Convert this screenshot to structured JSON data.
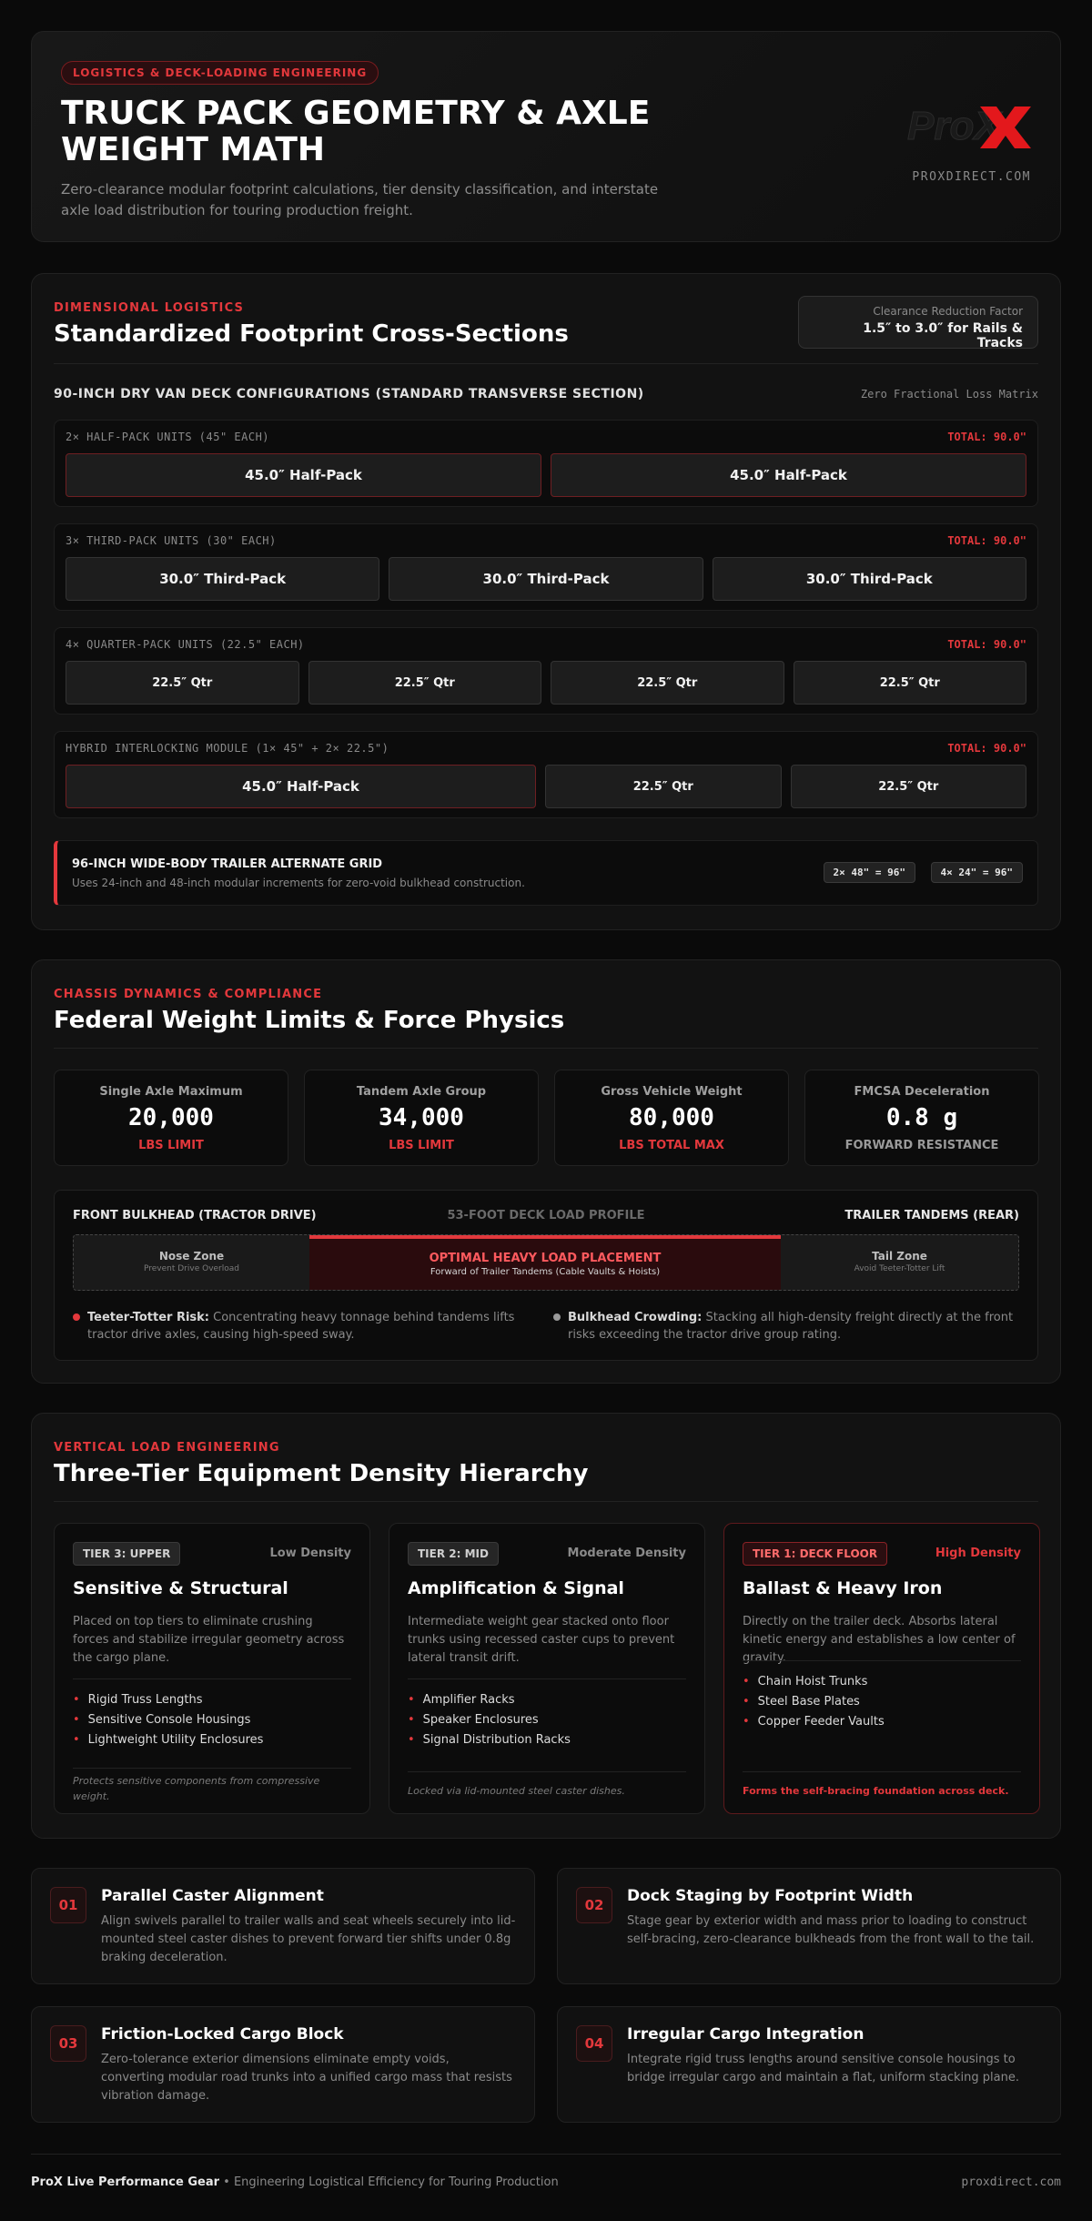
{
  "header": {
    "badge": "LOGISTICS & DECK-LOADING ENGINEERING",
    "title": "TRUCK PACK GEOMETRY & AXLE WEIGHT MATH",
    "subtitle": "Zero-clearance modular footprint calculations, tier density classification, and interstate axle load distribution for touring production freight.",
    "logo_text": "ProX",
    "site": "PROXDIRECT.COM"
  },
  "footprint": {
    "eyebrow": "DIMENSIONAL LOGISTICS",
    "title": "Standardized Footprint Cross-Sections",
    "clearance_label": "Clearance Reduction Factor",
    "clearance_value": "1.5″ to 3.0″ for Rails & Tracks",
    "section_title": "90-INCH DRY VAN DECK CONFIGURATIONS (STANDARD TRANSVERSE SECTION)",
    "section_note": "Zero Fractional Loss Matrix",
    "decks": [
      {
        "label": "2× HALF-PACK UNITS (45\" EACH)",
        "total": "TOTAL: 90.0\"",
        "units": [
          "45.0″ Half-Pack",
          "45.0″ Half-Pack"
        ]
      },
      {
        "label": "3× THIRD-PACK UNITS (30\" EACH)",
        "total": "TOTAL: 90.0\"",
        "units": [
          "30.0″ Third-Pack",
          "30.0″ Third-Pack",
          "30.0″ Third-Pack"
        ]
      },
      {
        "label": "4× QUARTER-PACK UNITS (22.5\" EACH)",
        "total": "TOTAL: 90.0\"",
        "units": [
          "22.5″ Qtr",
          "22.5″ Qtr",
          "22.5″ Qtr",
          "22.5″ Qtr"
        ]
      },
      {
        "label": "HYBRID INTERLOCKING MODULE (1× 45\" + 2× 22.5\")",
        "total": "TOTAL: 90.0\"",
        "units": [
          "45.0″ Half-Pack",
          "22.5″ Qtr",
          "22.5″ Qtr"
        ]
      }
    ],
    "alt_title": "96-INCH WIDE-BODY TRAILER ALTERNATE GRID",
    "alt_desc": "Uses 24-inch and 48-inch modular increments for zero-void bulkhead construction.",
    "alt_chip1": "2× 48\" = 96\"",
    "alt_chip2": "4× 24\" = 96\""
  },
  "weights": {
    "eyebrow": "CHASSIS DYNAMICS & COMPLIANCE",
    "title": "Federal Weight Limits & Force Physics",
    "stats": [
      {
        "label": "Single Axle Maximum",
        "value": "20,000",
        "sub": "LBS LIMIT",
        "sub_color": "#e3383c"
      },
      {
        "label": "Tandem Axle Group",
        "value": "34,000",
        "sub": "LBS LIMIT",
        "sub_color": "#e3383c"
      },
      {
        "label": "Gross Vehicle Weight",
        "value": "80,000",
        "sub": "LBS TOTAL MAX",
        "sub_color": "#e3383c"
      },
      {
        "label": "FMCSA Deceleration",
        "value": "0.8 g",
        "sub": "FORWARD RESISTANCE",
        "sub_color": "#9a9a9a"
      }
    ],
    "profile": {
      "left": "FRONT BULKHEAD (TRACTOR DRIVE)",
      "center": "53-FOOT DECK LOAD PROFILE",
      "right": "TRAILER TANDEMS (REAR)",
      "nose_title": "Nose Zone",
      "nose_sub": "Prevent Drive Overload",
      "optimal_title": "OPTIMAL HEAVY LOAD PLACEMENT",
      "optimal_sub": "Forward of Trailer Tandems (Cable Vaults & Hoists)",
      "tail_title": "Tail Zone",
      "tail_sub": "Avoid Teeter-Totter Lift",
      "risk1_title": "Teeter-Totter Risk:",
      "risk1_text": "Concentrating heavy tonnage behind tandems lifts tractor drive axles, causing high-speed sway.",
      "risk2_title": "Bulkhead Crowding:",
      "risk2_text": "Stacking all high-density freight directly at the front risks exceeding the tractor drive group rating."
    }
  },
  "tiers": {
    "eyebrow": "VERTICAL LOAD ENGINEERING",
    "title": "Three-Tier Equipment Density Hierarchy",
    "items": [
      {
        "tag": "TIER 3: UPPER",
        "density": "Low Density",
        "title": "Sensitive & Structural",
        "desc": "Placed on top tiers to eliminate crushing forces and stabilize irregular geometry across the cargo plane.",
        "list": [
          "Rigid Truss Lengths",
          "Sensitive Console Housings",
          "Lightweight Utility Enclosures"
        ],
        "note": "Protects sensitive components from compressive weight."
      },
      {
        "tag": "TIER 2: MID",
        "density": "Moderate Density",
        "title": "Amplification & Signal",
        "desc": "Intermediate weight gear stacked onto floor trunks using recessed caster cups to prevent lateral transit drift.",
        "list": [
          "Amplifier Racks",
          "Speaker Enclosures",
          "Signal Distribution Racks"
        ],
        "note": "Locked via lid-mounted steel caster dishes."
      },
      {
        "tag": "TIER 1: DECK FLOOR",
        "density": "High Density",
        "title": "Ballast & Heavy Iron",
        "desc": "Directly on the trailer deck. Absorbs lateral kinetic energy and establishes a low center of gravity.",
        "list": [
          "Chain Hoist Trunks",
          "Steel Base Plates",
          "Copper Feeder Vaults"
        ],
        "note": "Forms the self-bracing foundation across deck."
      }
    ]
  },
  "steps": [
    {
      "num": "01",
      "title": "Parallel Caster Alignment",
      "desc": "Align swivels parallel to trailer walls and seat wheels securely into lid-mounted steel caster dishes to prevent forward tier shifts under 0.8g braking deceleration."
    },
    {
      "num": "02",
      "title": "Dock Staging by Footprint Width",
      "desc": "Stage gear by exterior width and mass prior to loading to construct self-bracing, zero-clearance bulkheads from the front wall to the tail."
    },
    {
      "num": "03",
      "title": "Friction-Locked Cargo Block",
      "desc": "Zero-tolerance exterior dimensions eliminate empty voids, converting modular road trunks into a unified cargo mass that resists vibration damage."
    },
    {
      "num": "04",
      "title": "Irregular Cargo Integration",
      "desc": "Integrate rigid truss lengths around sensitive console housings to bridge irregular cargo and maintain a flat, uniform stacking plane."
    }
  ],
  "footer": {
    "brand": "ProX Live Performance Gear",
    "tagline": "• Engineering Logistical Efficiency for Touring Production",
    "site": "proxdirect.com"
  },
  "colors": {
    "accent": "#e3383c",
    "background": "#0a0a0a",
    "card": "#121212"
  }
}
